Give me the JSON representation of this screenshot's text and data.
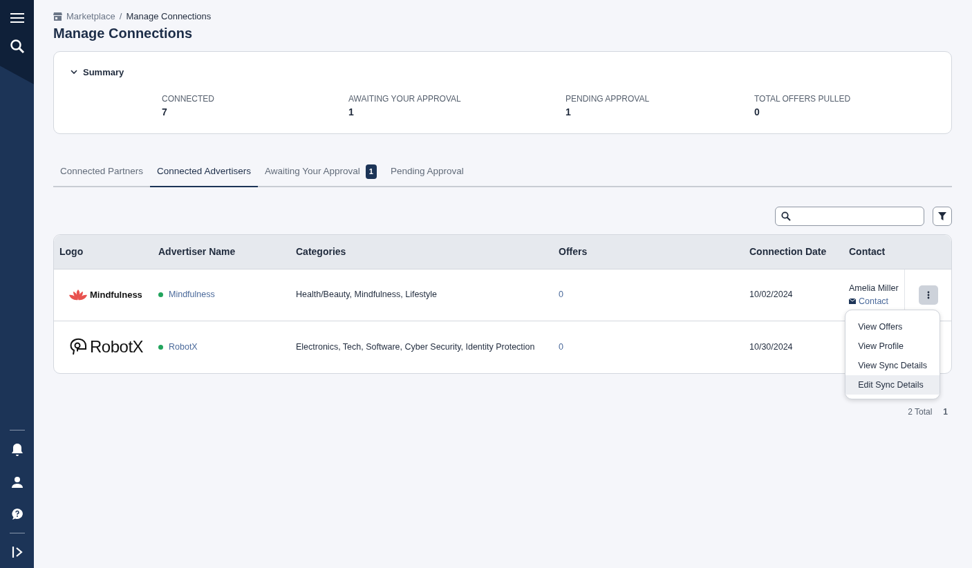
{
  "sidebar": {
    "top_items": [
      {
        "kind": "menu"
      },
      {
        "kind": "search"
      }
    ],
    "bottom_items": [
      {
        "kind": "bell"
      },
      {
        "kind": "user"
      },
      {
        "kind": "help"
      }
    ],
    "footer_item": {
      "kind": "expand"
    }
  },
  "breadcrumb": [
    {
      "label": "Marketplace",
      "current": false
    },
    {
      "label": "Manage Connections",
      "current": true
    }
  ],
  "breadcrumb_separator": "/",
  "title": "Manage Connections",
  "summary": {
    "title": "Summary",
    "expanded": true,
    "stats": [
      {
        "label": "CONNECTED",
        "value": "7"
      },
      {
        "label": "AWAITING YOUR APPROVAL",
        "value": "1"
      },
      {
        "label": "PENDING APPROVAL",
        "value": "1"
      },
      {
        "label": "TOTAL OFFERS PULLED",
        "value": "0"
      }
    ]
  },
  "tabs": [
    {
      "label": "Connected Partners",
      "selected": false
    },
    {
      "label": "Connected Advertisers",
      "selected": true
    },
    {
      "label": "Awaiting Your Approval",
      "selected": false,
      "badge": "1"
    },
    {
      "label": "Pending Approval",
      "selected": false
    }
  ],
  "table": {
    "columns": [
      "Logo",
      "Advertiser Name",
      "Categories",
      "Offers",
      "Connection Date",
      "Contact"
    ],
    "rows": [
      {
        "logo": {
          "kind": "lotus",
          "text": "Mindfulness"
        },
        "color": "#22a45d",
        "name": "Mindfulness",
        "categories": "Health/Beauty, Mindfulness, Lifestyle",
        "offers": "0",
        "date": "10/02/2024",
        "contact_name": "Amelia Miller",
        "contact_link": "Contact",
        "actions": true
      },
      {
        "logo": {
          "kind": "robot",
          "text": "RobotX"
        },
        "color": "#22a45d",
        "name": "RobotX",
        "categories": "Electronics, Tech, Software, Cyber Security, Identity Protection",
        "offers": "0",
        "date": "10/30/2024"
      }
    ]
  },
  "pagination": {
    "total": "2 Total",
    "page": "1"
  },
  "menu": {
    "items": [
      {
        "label": "View Offers",
        "selected": false
      },
      {
        "label": "View Profile",
        "selected": false
      },
      {
        "label": "View Sync Details",
        "selected": false
      },
      {
        "label": "Edit Sync Details",
        "selected": true
      }
    ]
  }
}
